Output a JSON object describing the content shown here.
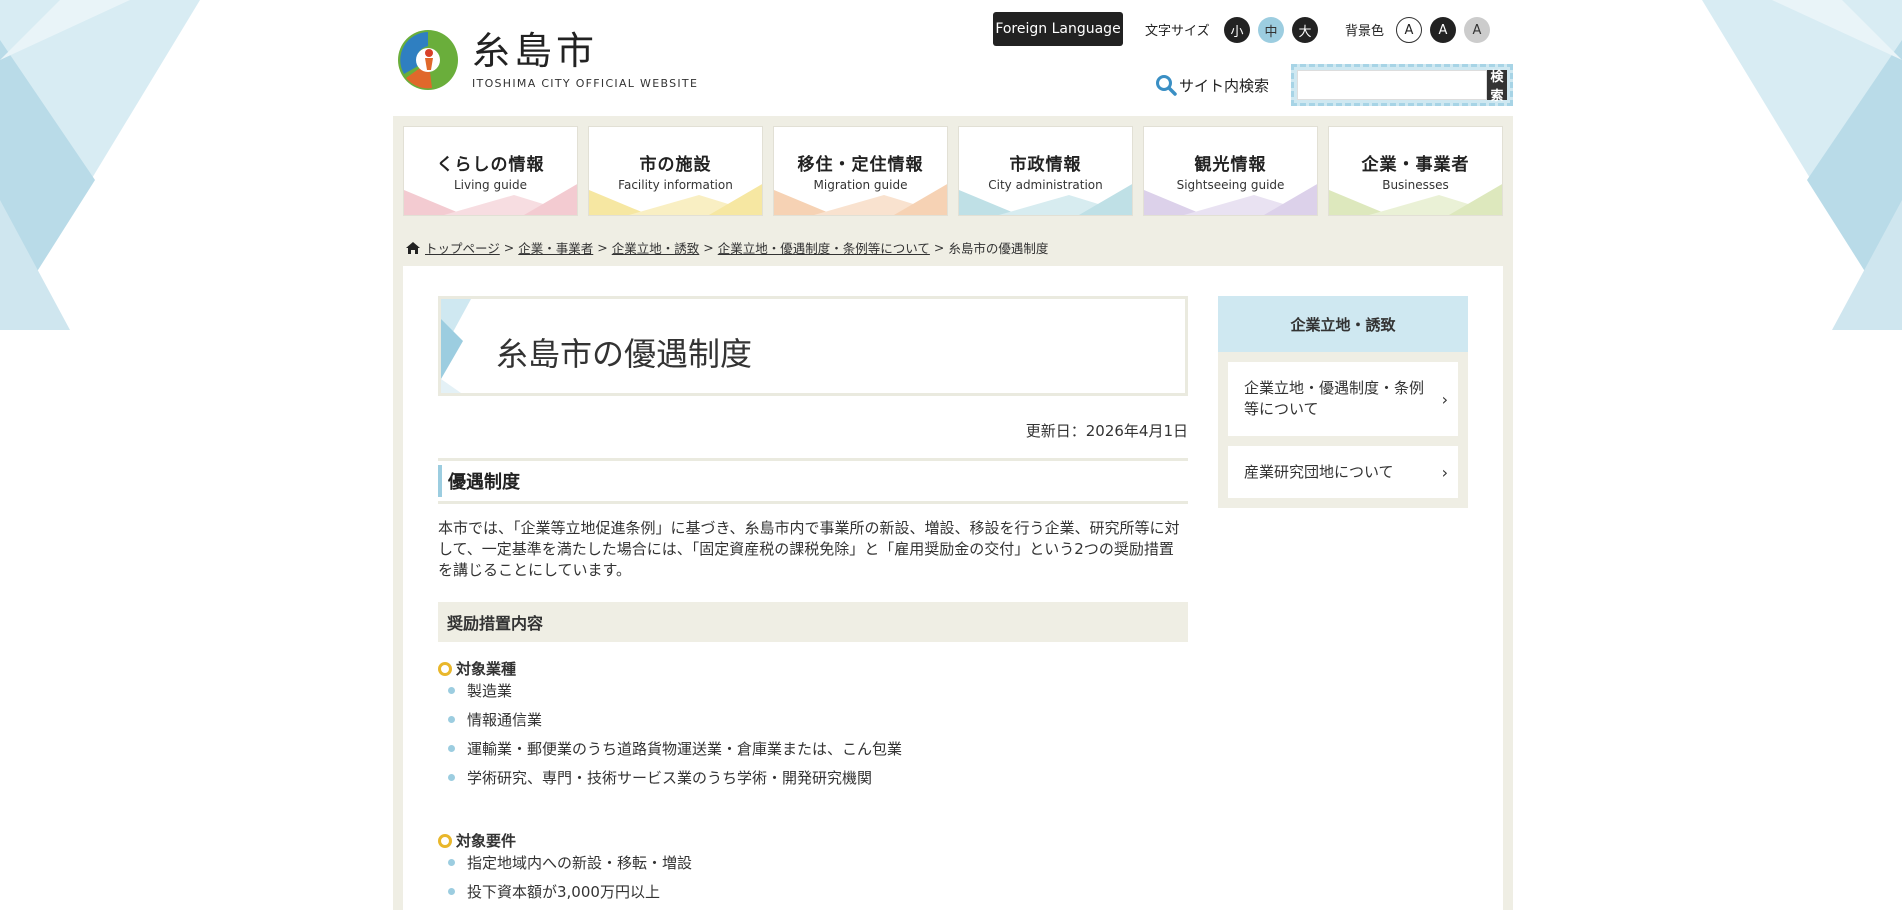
{
  "header": {
    "logo_jp": "糸島市",
    "logo_en": "ITOSHIMA CITY OFFICIAL WEBSITE",
    "foreign_language": "Foreign Language",
    "font_size_label": "文字サイズ",
    "font_size_options": [
      "小",
      "中",
      "大"
    ],
    "bg_color_label": "背景色",
    "bg_color_options": [
      "A",
      "A",
      "A"
    ],
    "search_label": "サイト内検索",
    "search_button": "検索",
    "search_placeholder": ""
  },
  "nav": [
    {
      "jp": "くらしの情報",
      "en": "Living guide",
      "color": "#f3cbd1"
    },
    {
      "jp": "市の施設",
      "en": "Facility information",
      "color": "#f6e7a2"
    },
    {
      "jp": "移住・定住情報",
      "en": "Migration guide",
      "color": "#f6d2b4"
    },
    {
      "jp": "市政情報",
      "en": "City administration",
      "color": "#bfe0e6"
    },
    {
      "jp": "観光情報",
      "en": "Sightseeing guide",
      "color": "#dcd1ea"
    },
    {
      "jp": "企業・事業者",
      "en": "Businesses",
      "color": "#dde8bd"
    }
  ],
  "breadcrumb": {
    "links": [
      "トップページ",
      "企業・事業者",
      "企業立地・誘致",
      "企業立地・優遇制度・条例等について"
    ],
    "current": "糸島市の優遇制度",
    "separator": ">"
  },
  "main": {
    "title": "糸島市の優遇制度",
    "updated": "更新日：2026年4月1日",
    "h2": "優遇制度",
    "paragraph": "本市では、「企業等立地促進条例」に基づき、糸島市内で事業所の新設、増設、移設を行う企業、研究所等に対して、一定基準を満たした場合には、「固定資産税の課税免除」と「雇用奨励金の交付」という2つの奨励措置を講じることにしています。",
    "h3": "奨励措置内容",
    "section1_title": "対象業種",
    "section1_items": [
      "製造業",
      "情報通信業",
      "運輸業・郵便業のうち道路貨物運送業・倉庫業または、こん包業",
      "学術研究、専門・技術サービス業のうち学術・開発研究機関"
    ],
    "section2_title": "対象要件",
    "section2_items": [
      "指定地域内への新設・移転・増設",
      "投下資本額が3,000万円以上"
    ]
  },
  "sidebar": {
    "heading": "企業立地・誘致",
    "links": [
      "企業立地・優遇制度・条例等について",
      "産業研究団地について"
    ]
  },
  "colors": {
    "accent_blue": "#9ccde0",
    "accent_yellow": "#e9b72b",
    "frame": "#efeee4"
  }
}
